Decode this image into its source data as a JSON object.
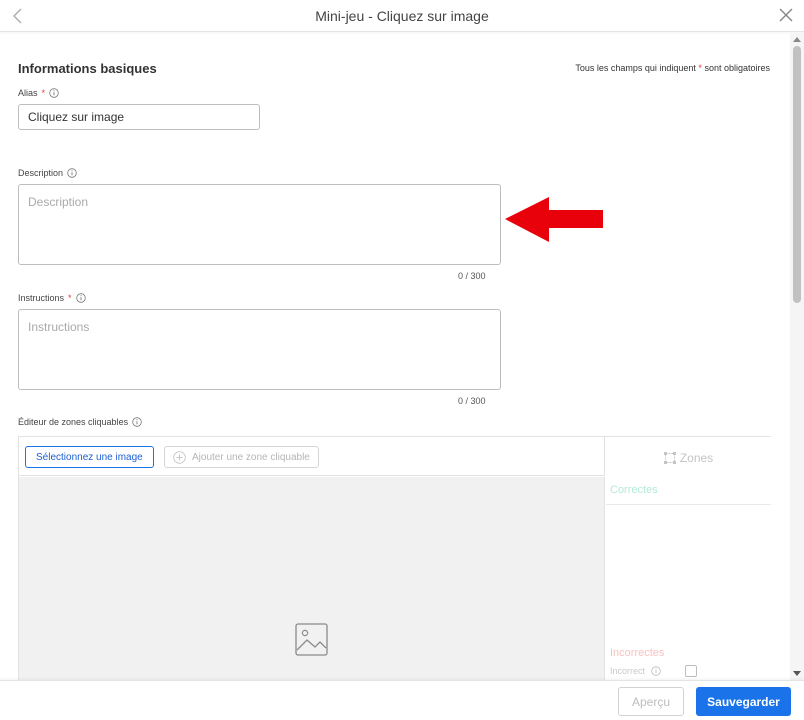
{
  "window": {
    "title": "Mini-jeu - Cliquez sur image"
  },
  "form": {
    "section_title": "Informations basiques",
    "required_note_prefix": "Tous les champs qui indiquent",
    "required_note_star": "*",
    "required_note_suffix": "sont obligatoires",
    "alias": {
      "label": "Alias",
      "required_star": "*",
      "value": "Cliquez sur image"
    },
    "description": {
      "label": "Description",
      "placeholder": "Description",
      "counter": "0 / 300"
    },
    "instructions": {
      "label": "Instructions",
      "required_star": "*",
      "placeholder": "Instructions",
      "counter": "0 / 300"
    },
    "editor": {
      "label": "Éditeur de zones cliquables",
      "select_image_button": "Sélectionnez une image",
      "add_zone_button": "Ajouter une zone cliquable",
      "zones_title": "Zones",
      "correct_label": "Correctes",
      "incorrect_label": "Incorrectes",
      "incorrect_option": "Incorrect"
    }
  },
  "annotation": {
    "arrow_color": "#e8000b"
  },
  "footer": {
    "preview_button": "Aperçu",
    "save_button": "Sauvegarder"
  },
  "colors": {
    "accent": "#1a73e8",
    "required": "#e53935"
  }
}
